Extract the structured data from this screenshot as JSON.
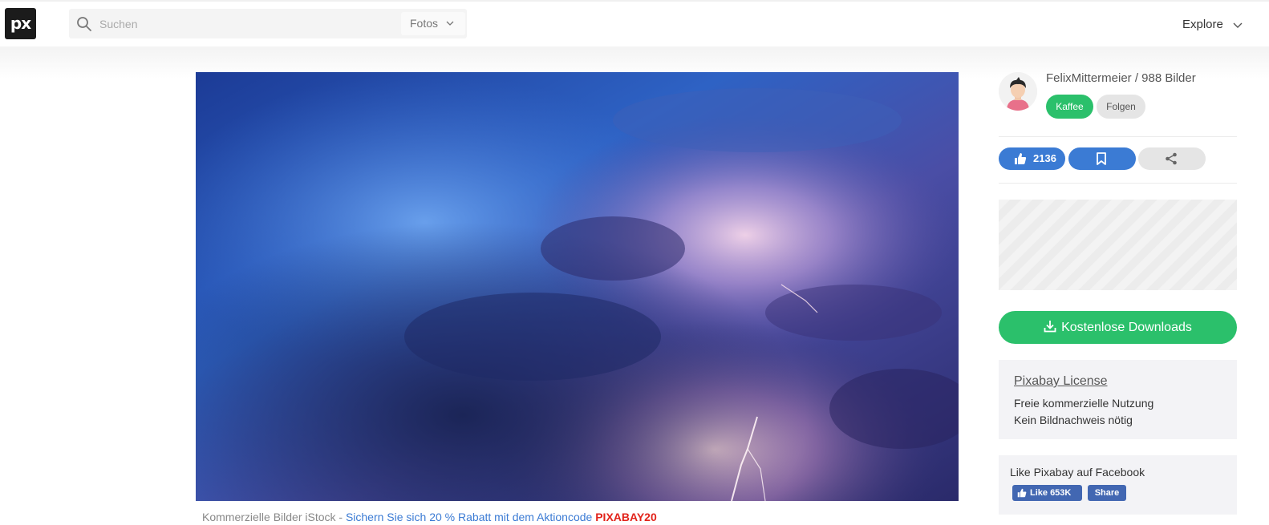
{
  "header": {
    "logo_text": "px",
    "search": {
      "placeholder": "Suchen",
      "value": ""
    },
    "media_type_select": "Fotos",
    "explore_label": "Explore"
  },
  "photo": {
    "description_colors": {
      "sky_top": "#1d3a8f",
      "sky_mid": "#3b6fd0",
      "cloud_purple": "#8a6ab8",
      "lightning_glow": "#f3c7d6"
    }
  },
  "promo": {
    "part1": "Kommerzielle Bilder iStock - ",
    "part2": "Sichern Sie sich 20 % Rabatt mit dem Aktioncode ",
    "code": "PIXABAY20"
  },
  "sidebar": {
    "user": {
      "name_line": "FelixMittermeier / 988 Bilder"
    },
    "coffee_label": "Kaffee",
    "follow_label": "Folgen",
    "likes_count": "2136",
    "download_label": "Kostenlose Downloads",
    "license": {
      "title": "Pixabay License",
      "line1": "Freie kommerzielle Nutzung",
      "line2": "Kein Bildnachweis nötig"
    },
    "facebook": {
      "title": "Like Pixabay auf Facebook",
      "like_label": "Like 653K",
      "share_label": "Share"
    }
  },
  "colors": {
    "accent_green": "#2bc06b",
    "accent_blue": "#3b7bd4",
    "promo_code_red": "#e2231a",
    "facebook_blue": "#4267b2"
  }
}
